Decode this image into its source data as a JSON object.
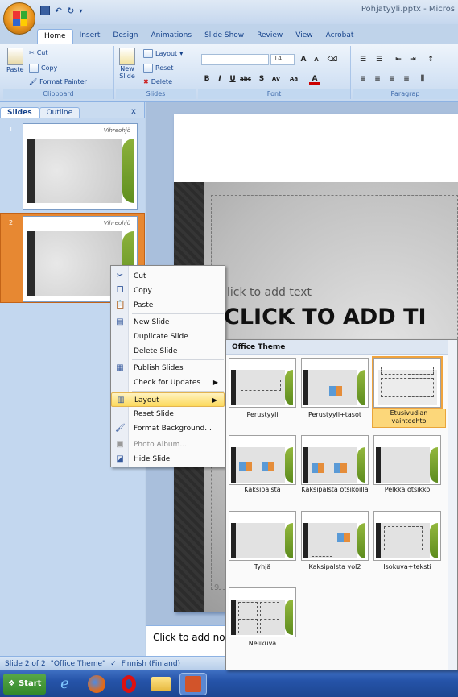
{
  "window": {
    "title": "Pohjatyyli.pptx - Micros"
  },
  "ribbon": {
    "tabs": [
      "Home",
      "Insert",
      "Design",
      "Animations",
      "Slide Show",
      "Review",
      "View",
      "Acrobat"
    ],
    "clipboard": {
      "paste": "Paste",
      "cut": "Cut",
      "copy": "Copy",
      "format_painter": "Format Painter",
      "label": "Clipboard"
    },
    "slides": {
      "new_slide_1": "New",
      "new_slide_2": "Slide",
      "layout": "Layout",
      "reset": "Reset",
      "delete": "Delete",
      "label": "Slides"
    },
    "font": {
      "size": "14",
      "label": "Font"
    },
    "paragraph": {
      "label": "Paragrap"
    }
  },
  "left_pane": {
    "tabs": [
      "Slides",
      "Outline"
    ],
    "close": "x",
    "thumbs": [
      {
        "num": "1",
        "logo": "Vihreohjö"
      },
      {
        "num": "2",
        "logo": "Vihreohjö"
      }
    ]
  },
  "slide": {
    "text_placeholder": "lick to add text",
    "title_placeholder": "CLICK TO ADD TI",
    "slide_num": "9.",
    "notes": "Click to add no"
  },
  "context_menu": {
    "items": [
      {
        "label": "Cut",
        "icon": "scissors-icon"
      },
      {
        "label": "Copy",
        "icon": "copy-icon"
      },
      {
        "label": "Paste",
        "icon": "paste-icon"
      },
      {
        "label": "New Slide",
        "icon": "new-slide-icon"
      },
      {
        "label": "Duplicate Slide",
        "icon": ""
      },
      {
        "label": "Delete Slide",
        "icon": ""
      },
      {
        "label": "Publish Slides",
        "icon": "publish-icon"
      },
      {
        "label": "Check for Updates",
        "icon": ""
      },
      {
        "label": "Layout",
        "icon": "layout-icon"
      },
      {
        "label": "Reset Slide",
        "icon": ""
      },
      {
        "label": "Format Background...",
        "icon": "format-background-icon"
      },
      {
        "label": "Photo Album...",
        "icon": "photo-album-icon"
      },
      {
        "label": "Hide Slide",
        "icon": "hide-slide-icon"
      }
    ]
  },
  "layout_gallery": {
    "header": "Office Theme",
    "layouts": [
      "Perustyyli",
      "Perustyyli+tasot",
      "Etusivudian vaihtoehto",
      "Kaksipalsta",
      "Kaksipalsta otsikoilla",
      "Pelkkä otsikko",
      "Tyhjä",
      "Kaksipalsta vol2",
      "Isokuva+teksti",
      "Nelikuva"
    ]
  },
  "status_bar": {
    "slide": "Slide 2 of 2",
    "theme": "\"Office Theme\"",
    "language": "Finnish (Finland)"
  },
  "taskbar": {
    "start": "Start"
  },
  "colors": {
    "accent": "#e78832",
    "ribbon": "#d6e4f5",
    "green": "#7aa530"
  }
}
